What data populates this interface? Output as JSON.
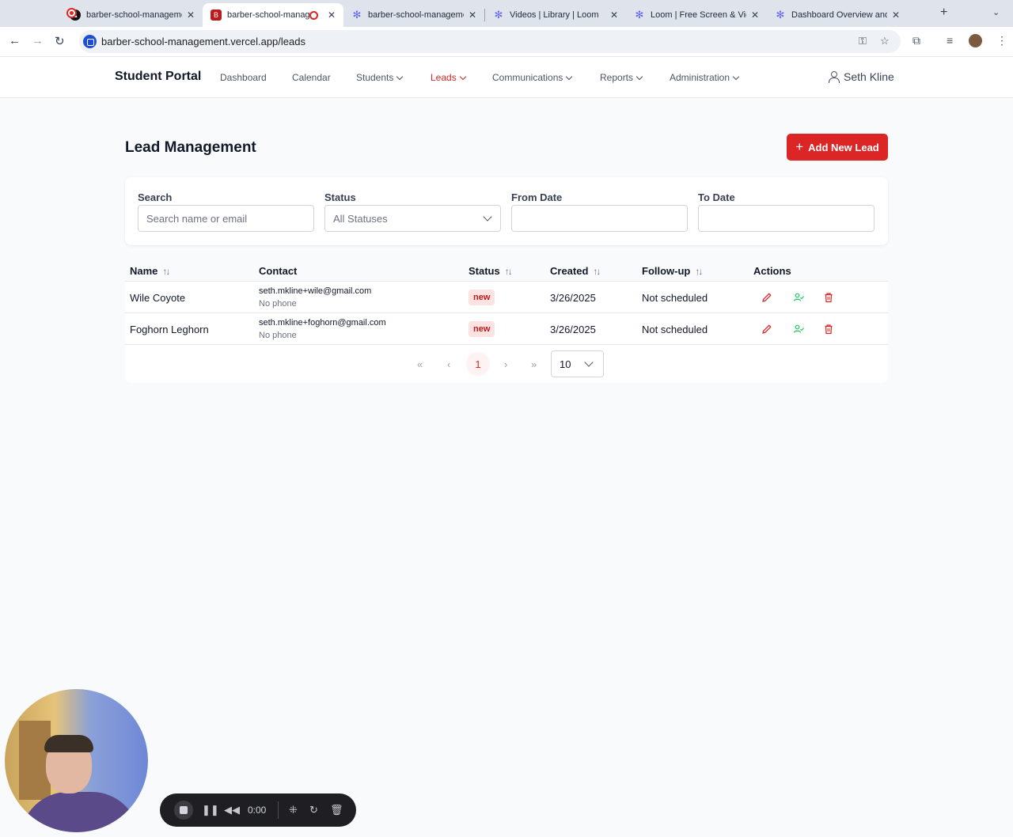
{
  "browser": {
    "tabs": [
      {
        "title": "barber-school-manageme",
        "favicon": "vercel-icon",
        "active": false
      },
      {
        "title": "barber-school-manag",
        "favicon": "app-favicon",
        "active": true,
        "recording": true
      },
      {
        "title": "barber-school-manageme",
        "favicon": "gear-icon",
        "active": false
      },
      {
        "title": "Videos | Library | Loom",
        "favicon": "loom-icon",
        "active": false
      },
      {
        "title": "Loom | Free Screen & Vid",
        "favicon": "loom-icon",
        "active": false
      },
      {
        "title": "Dashboard Overview and",
        "favicon": "loom-icon",
        "active": false
      }
    ],
    "url": "barber-school-management.vercel.app/leads"
  },
  "nav": {
    "brand": "Student Portal",
    "items": [
      {
        "label": "Dashboard",
        "dropdown": false,
        "active": false
      },
      {
        "label": "Calendar",
        "dropdown": false,
        "active": false
      },
      {
        "label": "Students",
        "dropdown": true,
        "active": false
      },
      {
        "label": "Leads",
        "dropdown": true,
        "active": true
      },
      {
        "label": "Communications",
        "dropdown": true,
        "active": false
      },
      {
        "label": "Reports",
        "dropdown": true,
        "active": false
      },
      {
        "label": "Administration",
        "dropdown": true,
        "active": false
      }
    ],
    "user": "Seth Kline"
  },
  "page": {
    "title": "Lead Management",
    "add_button": "Add New Lead"
  },
  "filters": {
    "search_label": "Search",
    "search_placeholder": "Search name or email",
    "status_label": "Status",
    "status_value": "All Statuses",
    "from_label": "From Date",
    "to_label": "To Date"
  },
  "table": {
    "headers": {
      "name": "Name",
      "contact": "Contact",
      "status": "Status",
      "created": "Created",
      "followup": "Follow-up",
      "actions": "Actions"
    },
    "rows": [
      {
        "name": "Wile Coyote",
        "email": "seth.mkline+wile@gmail.com",
        "phone": "No phone",
        "status": "new",
        "created": "3/26/2025",
        "followup": "Not scheduled"
      },
      {
        "name": "Foghorn Leghorn",
        "email": "seth.mkline+foghorn@gmail.com",
        "phone": "No phone",
        "status": "new",
        "created": "3/26/2025",
        "followup": "Not scheduled"
      }
    ]
  },
  "pagination": {
    "first": "«",
    "prev": "‹",
    "current": "1",
    "next": "›",
    "last": "»",
    "page_size": "10"
  },
  "loom": {
    "time": "0:00"
  },
  "colors": {
    "accent": "#dc2626",
    "badge_bg": "#fde2e2",
    "convert_icon": "#22c55e"
  }
}
